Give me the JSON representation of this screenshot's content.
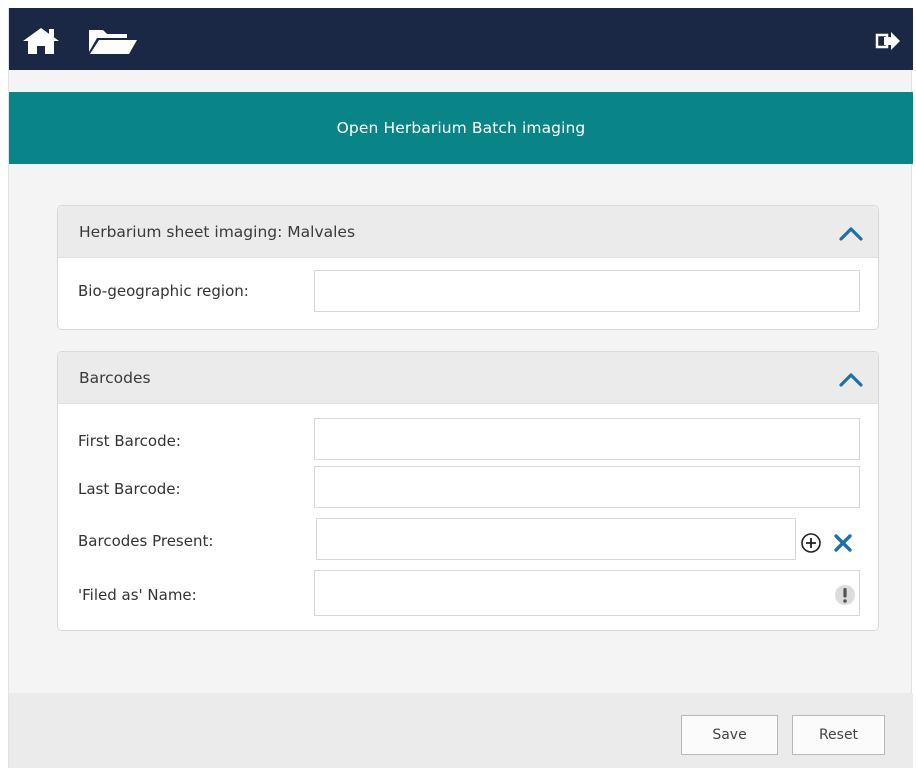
{
  "header": {
    "title": "Open Herbarium Batch imaging"
  },
  "nav": {
    "icons": [
      "home-icon",
      "folder-icon",
      "logout-icon"
    ]
  },
  "panels": [
    {
      "title": "Herbarium sheet imaging: Malvales",
      "fields": [
        {
          "label": "Bio-geographic region:",
          "value": "",
          "placeholder": ""
        }
      ]
    },
    {
      "title": "Barcodes",
      "fields": [
        {
          "label": "First Barcode:",
          "value": "",
          "placeholder": ""
        },
        {
          "label": "Last Barcode:",
          "value": "",
          "placeholder": ""
        },
        {
          "label": "Barcodes Present:",
          "value": "",
          "placeholder": ""
        },
        {
          "label": "'Filed as' Name:",
          "value": "",
          "placeholder": ""
        }
      ]
    }
  ],
  "footer": {
    "save_label": "Save",
    "reset_label": "Reset"
  },
  "colors": {
    "topbar": "#1b2845",
    "header_band": "#098588",
    "icon_blue": "#1f6fa8"
  }
}
